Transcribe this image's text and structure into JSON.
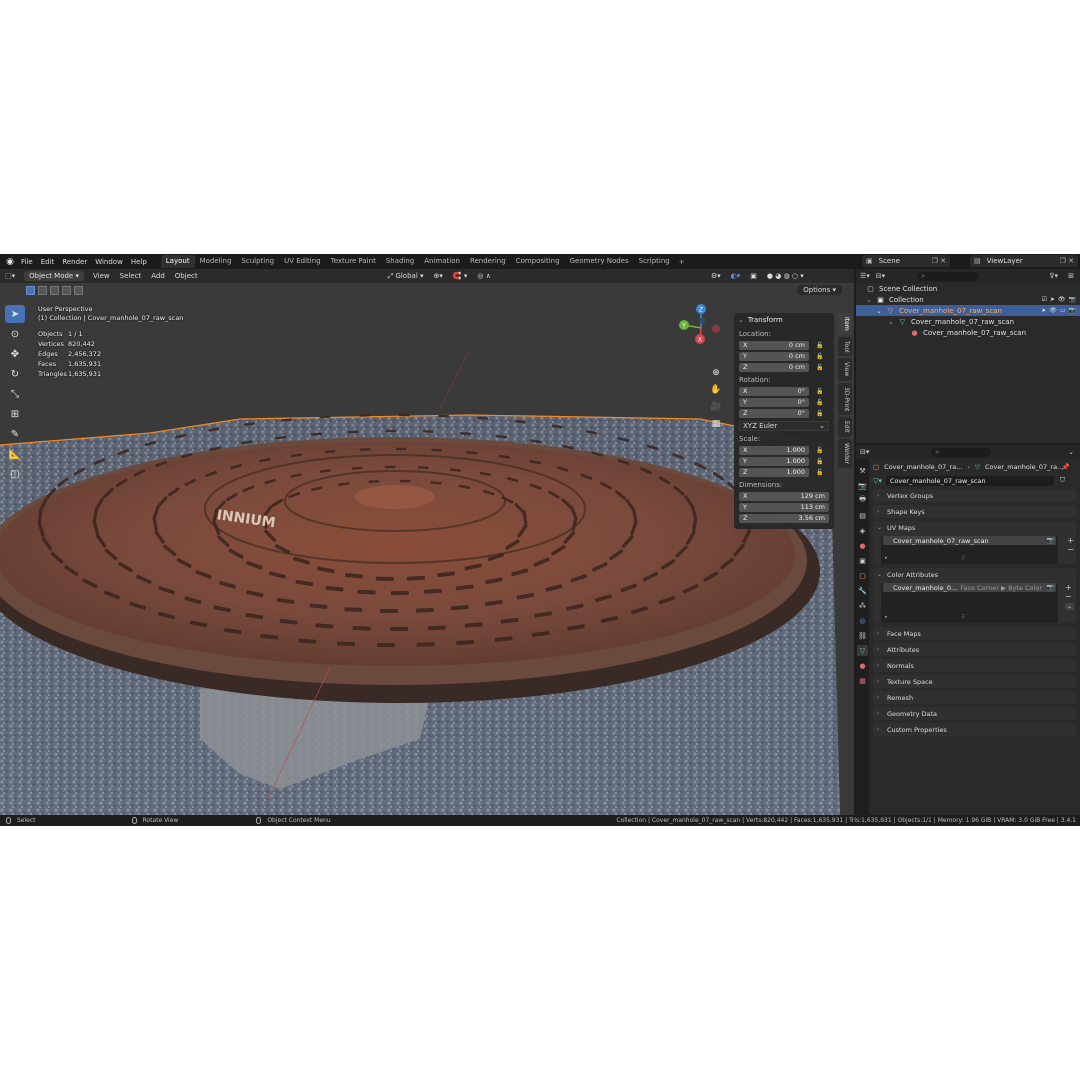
{
  "menu": {
    "items": [
      "File",
      "Edit",
      "Render",
      "Window",
      "Help"
    ]
  },
  "workspaces": {
    "tabs": [
      "Layout",
      "Modeling",
      "Sculpting",
      "UV Editing",
      "Texture Paint",
      "Shading",
      "Animation",
      "Rendering",
      "Compositing",
      "Geometry Nodes",
      "Scripting"
    ],
    "active_index": 0
  },
  "topbar": {
    "scene": "Scene",
    "view_layer": "ViewLayer"
  },
  "viewport": {
    "header": {
      "mode": "Object Mode",
      "menus": [
        "View",
        "Select",
        "Add",
        "Object"
      ],
      "orientation": "Global",
      "options_label": "Options"
    },
    "overlay": {
      "view_name": "User Perspective",
      "collection": "(1) Collection | Cover_manhole_07_raw_scan",
      "stats": [
        {
          "label": "Objects",
          "value": "1 / 1"
        },
        {
          "label": "Vertices",
          "value": "820,442"
        },
        {
          "label": "Edges",
          "value": "2,456,372"
        },
        {
          "label": "Faces",
          "value": "1,635,931"
        },
        {
          "label": "Triangles",
          "value": "1,635,931"
        }
      ],
      "scan_text": "INNIUM"
    },
    "gizmo_axes": [
      "X",
      "Y",
      "Z"
    ],
    "npanel": {
      "title": "Transform",
      "location_label": "Location:",
      "location": [
        {
          "axis": "X",
          "value": "0 cm"
        },
        {
          "axis": "Y",
          "value": "0 cm"
        },
        {
          "axis": "Z",
          "value": "0 cm"
        }
      ],
      "rotation_label": "Rotation:",
      "rotation": [
        {
          "axis": "X",
          "value": "0°"
        },
        {
          "axis": "Y",
          "value": "0°"
        },
        {
          "axis": "Z",
          "value": "0°"
        }
      ],
      "rotation_mode": "XYZ Euler",
      "scale_label": "Scale:",
      "scale": [
        {
          "axis": "X",
          "value": "1.000"
        },
        {
          "axis": "Y",
          "value": "1.000"
        },
        {
          "axis": "Z",
          "value": "1.000"
        }
      ],
      "dimensions_label": "Dimensions:",
      "dimensions": [
        {
          "axis": "X",
          "value": "129 cm"
        },
        {
          "axis": "Y",
          "value": "113 cm"
        },
        {
          "axis": "Z",
          "value": "3.56 cm"
        }
      ]
    },
    "side_tabs": [
      "Item",
      "Tool",
      "View",
      "3D-Print",
      "Edit",
      "Welder"
    ]
  },
  "outliner": {
    "rows": [
      {
        "label": "Scene Collection"
      },
      {
        "label": "Collection"
      },
      {
        "label": "Cover_manhole_07_raw_scan"
      },
      {
        "label": "Cover_manhole_07_raw_scan"
      },
      {
        "label": "Cover_manhole_07_raw_scan"
      }
    ]
  },
  "properties": {
    "breadcrumb": [
      "Cover_manhole_07_ra...",
      "Cover_manhole_07_ra..."
    ],
    "mesh_name": "Cover_manhole_07_raw_scan",
    "panels": {
      "vertex_groups": "Vertex Groups",
      "shape_keys": "Shape Keys",
      "uv_maps": "UV Maps",
      "uv_map_item": "Cover_manhole_07_raw_scan",
      "color_attributes": "Color Attributes",
      "color_attr_item": "Cover_manhole_0...",
      "color_attr_domain": "Face Corner ▶ Byte Color",
      "face_maps": "Face Maps",
      "attributes": "Attributes",
      "normals": "Normals",
      "texture_space": "Texture Space",
      "remesh": "Remesh",
      "geometry_data": "Geometry Data",
      "custom_properties": "Custom Properties"
    }
  },
  "statusbar": {
    "select": "Select",
    "rotate": "Rotate View",
    "context": "Object Context Menu",
    "info": "Collection | Cover_manhole_07_raw_scan | Verts:820,442 | Faces:1,635,931 | Tris:1,635,931 | Objects:1/1 | Memory: 1.96 GiB | VRAM: 3.0 GiB Free | 3.4.1"
  },
  "colors": {
    "accent": "#4772b3",
    "selection_outline": "#f08a24",
    "axis_x": "#d64452",
    "axis_y": "#6bb33b",
    "axis_z": "#3d88d8"
  }
}
